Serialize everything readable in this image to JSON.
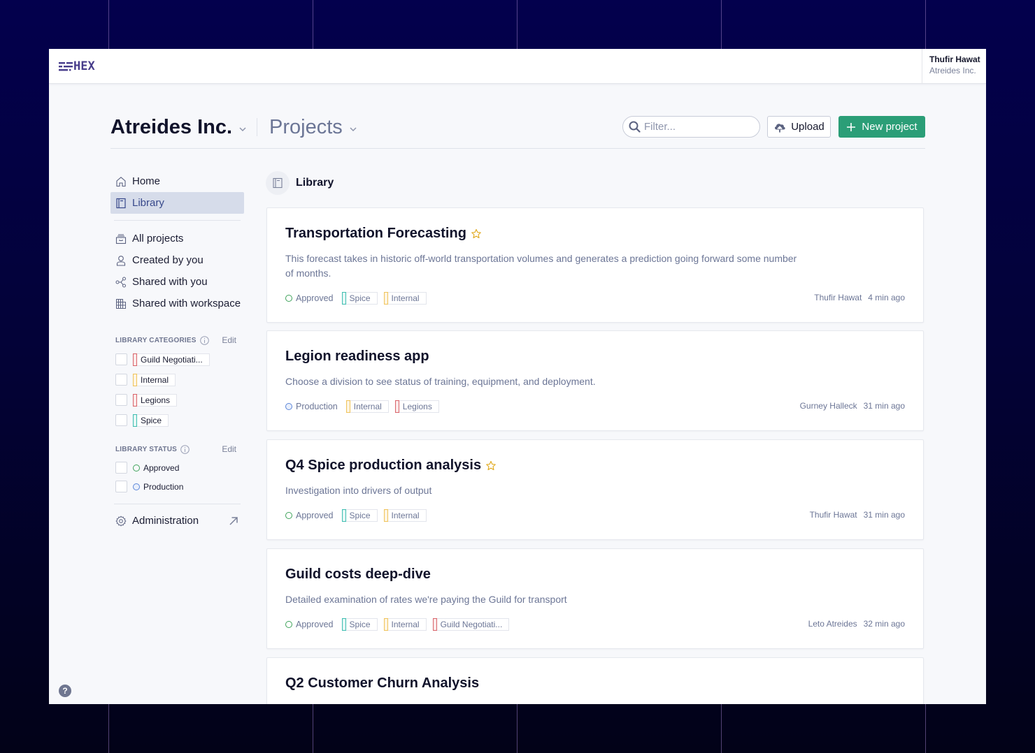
{
  "colors": {
    "brand": "#473c8b",
    "primary_button": "#2b9e77",
    "approved": "#3fa35b",
    "production": "#5b86d9",
    "tag_spice": "#3dbdb0",
    "tag_internal": "#f0c35a",
    "tag_legions": "#d9646a",
    "tag_guild": "#d9646a",
    "star": "#e0a81b"
  },
  "app": {
    "logo_text": "HEX",
    "user": {
      "name": "Thufir Hawat",
      "org": "Atreides Inc."
    }
  },
  "header": {
    "org_title": "Atreides Inc.",
    "section_title": "Projects",
    "filter_placeholder": "Filter...",
    "filter_value": "",
    "upload_label": "Upload",
    "new_project_label": "New project"
  },
  "sidebar": {
    "primary": [
      {
        "label": "Home",
        "icon": "home-icon"
      },
      {
        "label": "Library",
        "icon": "library-icon",
        "active": true
      }
    ],
    "projects": [
      {
        "label": "All projects",
        "icon": "archive-icon"
      },
      {
        "label": "Created by you",
        "icon": "user-icon"
      },
      {
        "label": "Shared with you",
        "icon": "share-icon"
      },
      {
        "label": "Shared with workspace",
        "icon": "building-icon"
      }
    ],
    "categories": {
      "heading": "LIBRARY CATEGORIES",
      "edit_label": "Edit",
      "items": [
        {
          "label": "Guild Negotiati...",
          "color": "#d9646a"
        },
        {
          "label": "Internal",
          "color": "#f0c35a"
        },
        {
          "label": "Legions",
          "color": "#d9646a"
        },
        {
          "label": "Spice",
          "color": "#3dbdb0"
        }
      ]
    },
    "statuses": {
      "heading": "LIBRARY STATUS",
      "edit_label": "Edit",
      "items": [
        {
          "label": "Approved",
          "color": "#3fa35b"
        },
        {
          "label": "Production",
          "color": "#5b86d9"
        }
      ]
    },
    "administration_label": "Administration"
  },
  "main": {
    "title": "Library",
    "projects": [
      {
        "title": "Transportation Forecasting",
        "starred": true,
        "description": "This forecast takes in historic off-world transportation volumes and generates a prediction going forward some number of months.",
        "status": "Approved",
        "tags": [
          "Spice",
          "Internal"
        ],
        "author": "Thufir Hawat",
        "updated": "4 min ago"
      },
      {
        "title": "Legion readiness app",
        "starred": false,
        "description": "Choose a division to see status of training, equipment, and deployment.",
        "status": "Production",
        "tags": [
          "Internal",
          "Legions"
        ],
        "author": "Gurney Halleck",
        "updated": "31 min ago"
      },
      {
        "title": "Q4 Spice production analysis",
        "starred": true,
        "description": "Investigation into drivers of output",
        "status": "Approved",
        "tags": [
          "Spice",
          "Internal"
        ],
        "author": "Thufir Hawat",
        "updated": "31 min ago"
      },
      {
        "title": "Guild costs deep-dive",
        "starred": false,
        "description": "Detailed examination of rates we're paying the Guild for transport",
        "status": "Approved",
        "tags": [
          "Spice",
          "Internal",
          "Guild Negotiati..."
        ],
        "author": "Leto Atreides",
        "updated": "32 min ago"
      },
      {
        "title": "Q2 Customer Churn Analysis",
        "starred": false,
        "description": "",
        "status": "",
        "tags": [],
        "author": "",
        "updated": ""
      }
    ]
  },
  "help_label": "?"
}
